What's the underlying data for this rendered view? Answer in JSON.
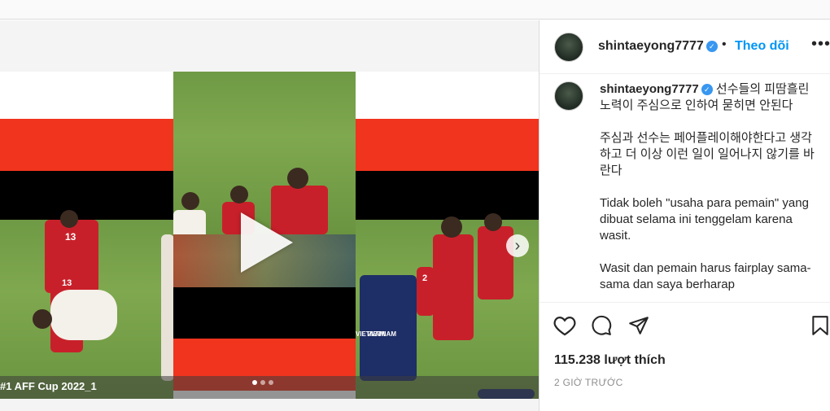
{
  "post": {
    "username": "shintaeyong7777",
    "follow_label": "Theo dõi",
    "separator": "•",
    "more_label": "•••",
    "caption_username": "shintaeyong7777",
    "caption_line1": "선수들의 피땀흘린 노력이 주심으로 인하여 묻히면 안된다",
    "caption_p2": "주심과 선수는 페어플레이해야한다고 생각하고 더 이상 이런 일이 일어나지 않기를 바란다",
    "caption_p3": "Tidak boleh \"usaha para pemain\" yang dibuat selama ini tenggelam karena wasit.",
    "caption_p4": "Wasit dan pemain harus fairplay sama-sama dan saya berharap",
    "likes": "115.238 lượt thích",
    "time": "2 GIỜ TRƯỚC"
  },
  "media": {
    "overlay_text": "#1 AFF Cup 2022_1",
    "jersey_left_1": "13",
    "jersey_left_2": "13",
    "jersey_right": "2",
    "vietnam_label": "VIETNAM",
    "carousel_count": 3,
    "carousel_active": 0
  },
  "icons": {
    "verified": "verified-badge-icon",
    "like": "heart-icon",
    "comment": "comment-bubble-icon",
    "share": "paper-plane-icon",
    "save": "bookmark-icon",
    "next": "chevron-right-icon",
    "play": "play-icon"
  },
  "colors": {
    "link_blue": "#0095f6",
    "verified_blue": "#3897f0",
    "flag_red": "#f0341e",
    "muted": "#8e8e8e"
  }
}
